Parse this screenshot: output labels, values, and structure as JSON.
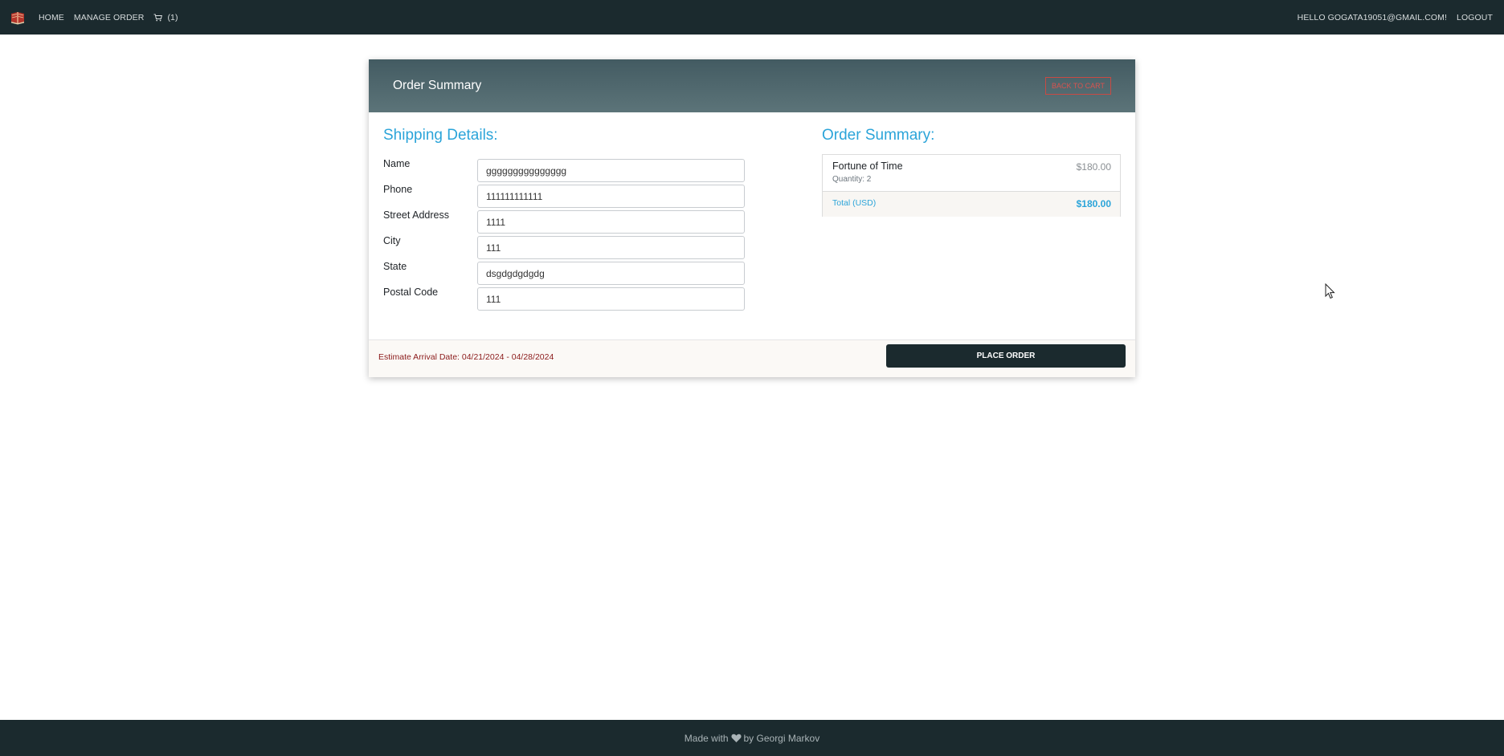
{
  "nav": {
    "home": "HOME",
    "manage_order": "MANAGE ORDER",
    "cart_count": "(1)",
    "greeting": "HELLO GOGATA19051@GMAIL.COM!",
    "logout": "LOGOUT"
  },
  "card": {
    "header_title": "Order Summary",
    "back_label": "BACK TO CART"
  },
  "shipping": {
    "title": "Shipping Details:",
    "fields": [
      {
        "label": "Name",
        "value": "ggggggggggggggg"
      },
      {
        "label": "Phone",
        "value": "111111111111"
      },
      {
        "label": "Street Address",
        "value": "1111"
      },
      {
        "label": "City",
        "value": "111"
      },
      {
        "label": "State",
        "value": "dsgdgdgdgdg"
      },
      {
        "label": "Postal Code",
        "value": "111"
      }
    ]
  },
  "summary": {
    "title": "Order Summary:",
    "item_name": "Fortune of Time",
    "item_quantity": "Quantity: 2",
    "item_price": "$180.00",
    "total_label": "Total (USD)",
    "total_value": "$180.00"
  },
  "footer_bar": {
    "arrival": "Estimate Arrival Date: 04/21/2024 - 04/28/2024",
    "place_order": "PLACE ORDER"
  },
  "page_footer": {
    "made_with": "Made with",
    "by": "by Georgi Markov"
  },
  "icons": {
    "logo": "book-logo-icon",
    "cart": "cart-icon",
    "heart": "heart-icon"
  },
  "colors": {
    "nav_bg": "#1b2a2e",
    "accent": "#2ba4d9",
    "danger": "#d9534f",
    "arrival": "#8b1a1a"
  }
}
